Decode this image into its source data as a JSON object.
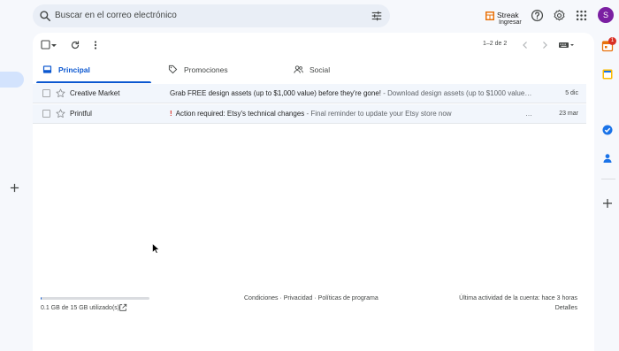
{
  "search": {
    "placeholder": "Buscar en el correo electrónico"
  },
  "streak": {
    "name": "Streak",
    "sub": "Ingresar"
  },
  "account": {
    "initial": "S",
    "color": "#7b1fa2"
  },
  "toolbar": {
    "count": "1–2 de 2"
  },
  "tabs": [
    {
      "label": "Principal",
      "icon": "inbox-icon",
      "active": true
    },
    {
      "label": "Promociones",
      "icon": "tag-icon",
      "active": false
    },
    {
      "label": "Social",
      "icon": "people-icon",
      "active": false
    }
  ],
  "emails": [
    {
      "sender": "Creative Market",
      "subject": "Grab FREE design assets (up to $1,000 value) before they're gone!",
      "snippet": " - Download design assets (up to $1000 value…",
      "date": "5 dic",
      "important": false
    },
    {
      "sender": "Printful",
      "subject": "Action required: Etsy's technical changes",
      "snippet": " - Final reminder to update your Etsy store now",
      "date": "23 mar",
      "important": true,
      "important_mark": "!",
      "trailing": "…"
    }
  ],
  "footer": {
    "storage": "0.1 GB de 15 GB utilizado(s)",
    "storage_fraction": 0.007,
    "links": "Condiciones · Privacidad · Políticas de programa",
    "activity": "Última actividad de la cuenta: hace 3 horas",
    "details": "Detalles"
  },
  "side_panel": {
    "badge": "1"
  },
  "colors": {
    "accent": "#0b57d0",
    "important": "#d93025",
    "background": "#f6f8fc"
  }
}
